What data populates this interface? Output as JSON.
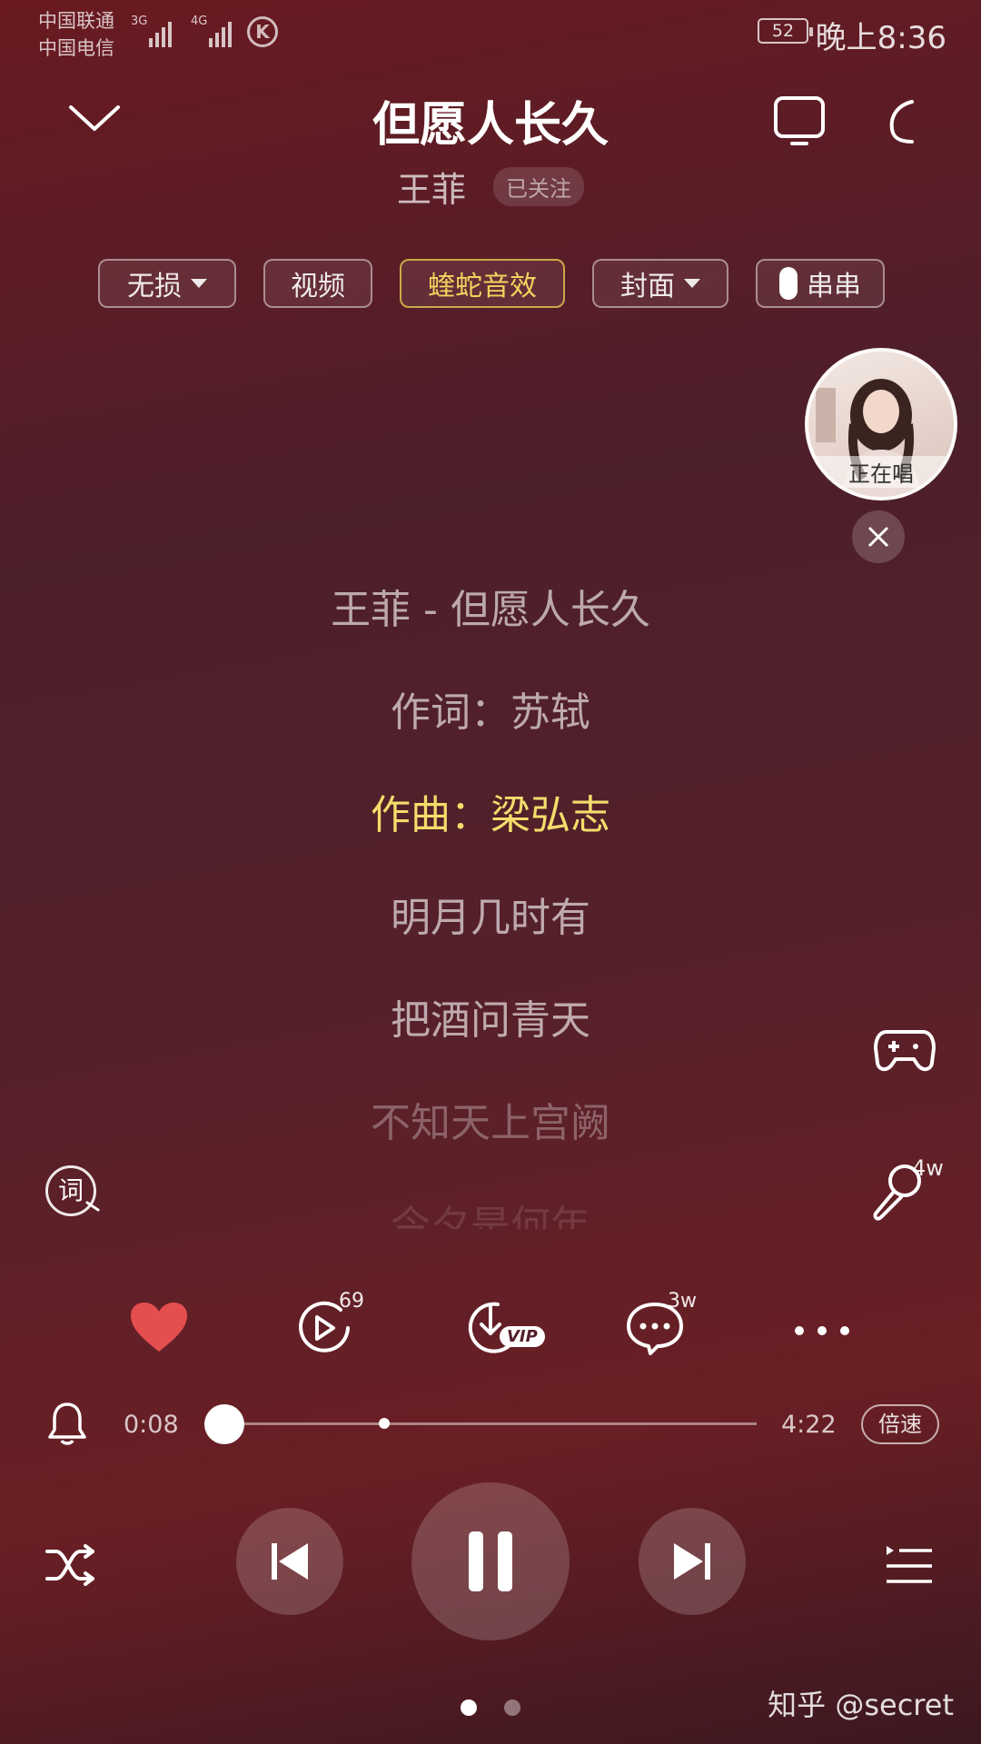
{
  "status_bar": {
    "carrier1": "中国联通",
    "carrier2": "中国电信",
    "net1": "3G",
    "net2": "4G",
    "battery": "52",
    "time": "晚上8:36"
  },
  "header": {
    "title": "但愿人长久",
    "artist": "王菲",
    "follow_status": "已关注"
  },
  "chips": {
    "lossless": "无损",
    "video": "视频",
    "sound_effect": "蝰蛇音效",
    "cover": "封面",
    "chuanchuan": "串串"
  },
  "singer_bubble": {
    "label": "正在唱"
  },
  "lyrics": [
    "王菲 - 但愿人长久",
    "作词：苏轼",
    "作曲：梁弘志",
    "明月几时有",
    "把酒问青天",
    "不知天上宫阙",
    "今夕是何年"
  ],
  "current_lyric_index": 2,
  "side_buttons": {
    "lyrics_search": "词",
    "karaoke_count": "4w"
  },
  "actions": {
    "liked": true,
    "mv_count": "69",
    "download_badge": "VIP",
    "comments_count": "3w"
  },
  "playback": {
    "elapsed": "0:08",
    "total": "4:22",
    "progress": 0.03,
    "speed_label": "倍速"
  },
  "pager": {
    "current": 0,
    "count": 2
  },
  "watermark": "知乎 @secret",
  "colors": {
    "accent_gold": "#f4dd6b",
    "like_red": "#e54e4e"
  }
}
